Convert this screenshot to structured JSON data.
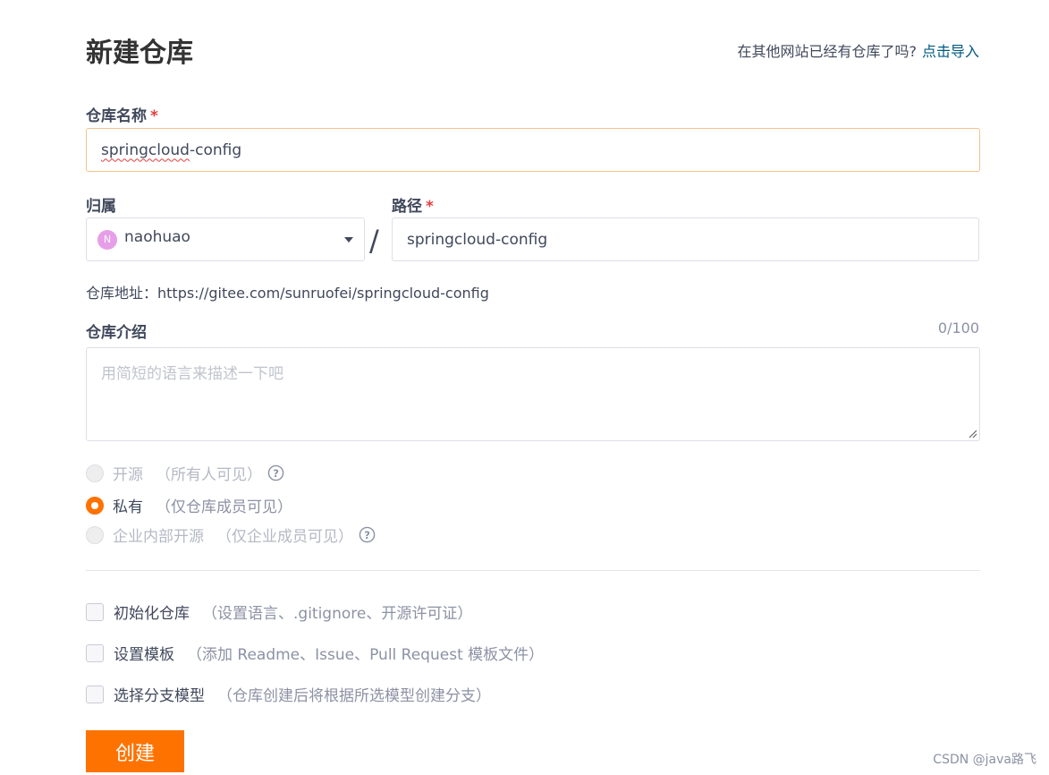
{
  "header": {
    "title": "新建仓库",
    "import_prompt": "在其他网站已经有仓库了吗?",
    "import_link": "点击导入"
  },
  "repo_name": {
    "label": "仓库名称",
    "required_mark": "*",
    "value_underlined": "springcloud",
    "value_rest": "-config"
  },
  "owner": {
    "label": "归属",
    "avatar_letter": "N",
    "name": "naohuao"
  },
  "path": {
    "separator": "/",
    "label": "路径",
    "required_mark": "*",
    "value": "springcloud-config"
  },
  "repo_address": "仓库地址：https://gitee.com/sunruofei/springcloud-config",
  "description": {
    "label": "仓库介绍",
    "counter": "0/100",
    "placeholder": "用简短的语言来描述一下吧"
  },
  "visibility": {
    "options": [
      {
        "label": "开源",
        "hint": "（所有人可见）",
        "checked": false,
        "disabled": true,
        "has_help": true
      },
      {
        "label": "私有",
        "hint": "（仅仓库成员可见）",
        "checked": true,
        "disabled": false,
        "has_help": false
      },
      {
        "label": "企业内部开源",
        "hint": "（仅企业成员可见）",
        "checked": false,
        "disabled": true,
        "has_help": true
      }
    ]
  },
  "options": [
    {
      "label": "初始化仓库",
      "hint": "（设置语言、.gitignore、开源许可证）",
      "checked": false
    },
    {
      "label": "设置模板",
      "hint": "（添加 Readme、Issue、Pull Request 模板文件）",
      "checked": false
    },
    {
      "label": "选择分支模型",
      "hint": "（仓库创建后将根据所选模型创建分支）",
      "checked": false
    }
  ],
  "create_button": "创建",
  "watermark": "CSDN @java路飞",
  "colors": {
    "accent": "#fe7300",
    "link": "#005980",
    "required": "#e43e3e",
    "avatar": "#e79ee8"
  }
}
